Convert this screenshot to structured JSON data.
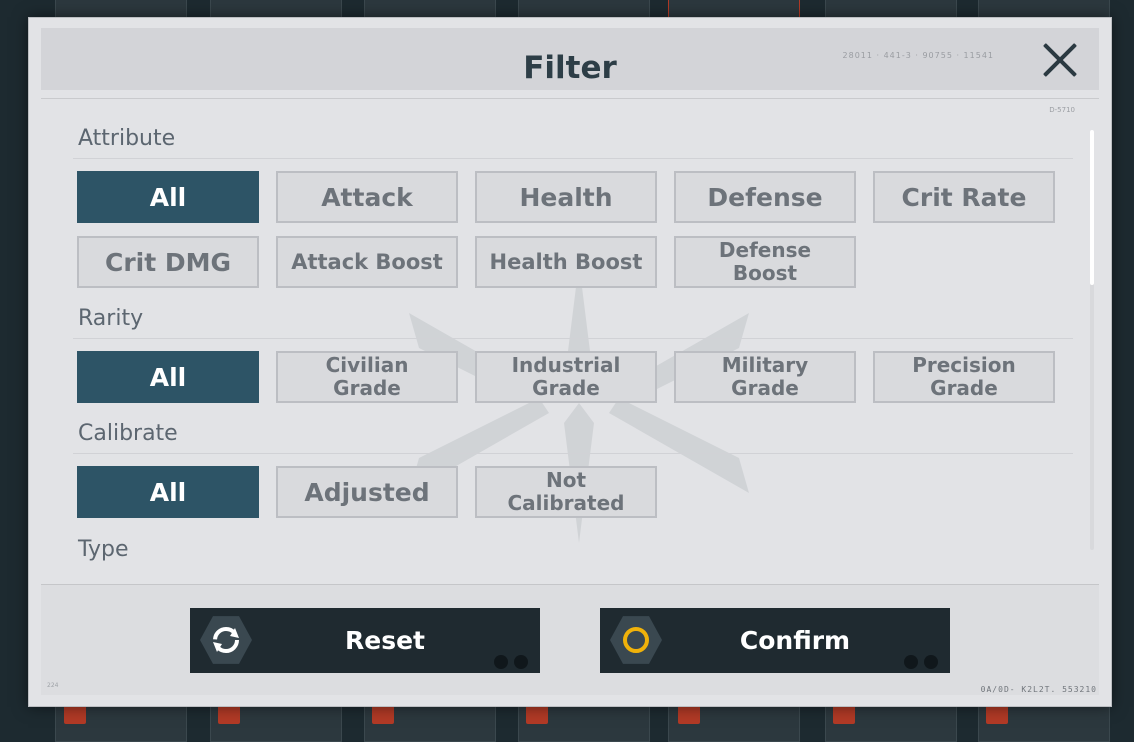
{
  "dialog": {
    "title": "Filter",
    "header_code": "28011 · 441-3 · 90755 · 11541",
    "side_code": "D-5710",
    "corner_code": "0A/0D- K2L2T. 553210",
    "corner_num": "224"
  },
  "sections": {
    "attribute": {
      "label": "Attribute",
      "options": [
        "All",
        "Attack",
        "Health",
        "Defense",
        "Crit Rate",
        "Crit DMG",
        "Attack Boost",
        "Health Boost",
        "Defense\nBoost"
      ],
      "selected": "All"
    },
    "rarity": {
      "label": "Rarity",
      "options": [
        "All",
        "Civilian\nGrade",
        "Industrial\nGrade",
        "Military\nGrade",
        "Precision\nGrade"
      ],
      "selected": "All"
    },
    "calibrate": {
      "label": "Calibrate",
      "options": [
        "All",
        "Adjusted",
        "Not\nCalibrated"
      ],
      "selected": "All"
    },
    "type": {
      "label": "Type"
    }
  },
  "actions": {
    "reset": {
      "label": "Reset",
      "icon": "refresh-icon"
    },
    "confirm": {
      "label": "Confirm",
      "icon": "ring-icon"
    }
  },
  "colors": {
    "active_chip": "#2d5466",
    "button_dark": "#1f2a30",
    "confirm_ring": "#f0b20a"
  }
}
